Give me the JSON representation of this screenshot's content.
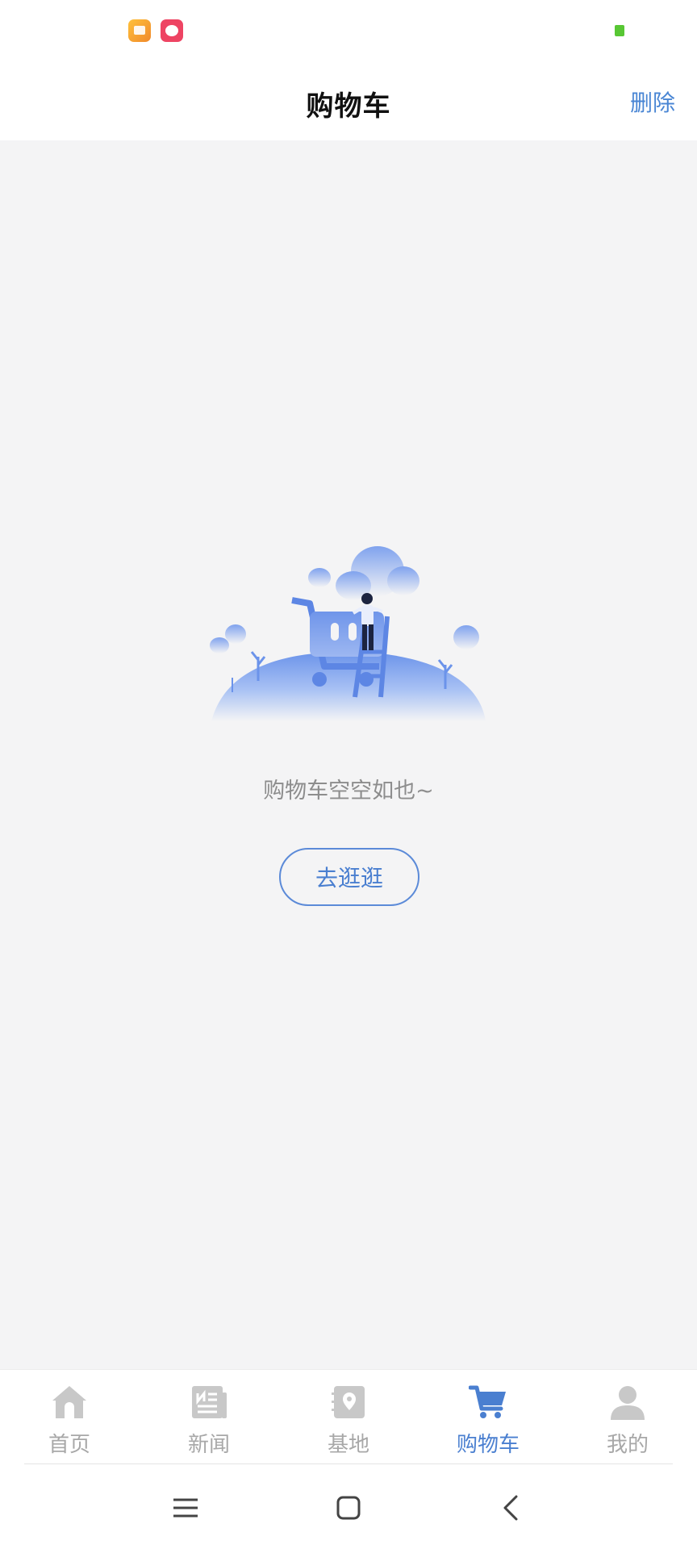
{
  "header": {
    "title": "购物车",
    "delete_label": "删除"
  },
  "empty_state": {
    "message": "购物车空空如也~",
    "button_label": "去逛逛"
  },
  "tabs": [
    {
      "label": "首页",
      "icon": "home-icon",
      "active": false
    },
    {
      "label": "新闻",
      "icon": "news-icon",
      "active": false
    },
    {
      "label": "基地",
      "icon": "location-icon",
      "active": false
    },
    {
      "label": "购物车",
      "icon": "cart-icon",
      "active": true
    },
    {
      "label": "我的",
      "icon": "user-icon",
      "active": false
    }
  ],
  "colors": {
    "accent": "#4a7fd0",
    "inactive": "#c8c8c8",
    "background": "#f4f4f5"
  }
}
